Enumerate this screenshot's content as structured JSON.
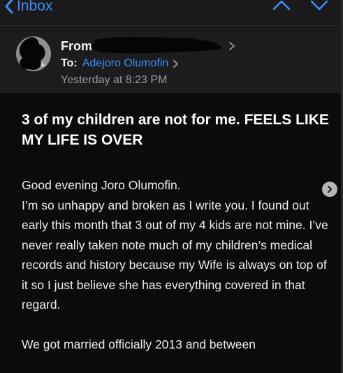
{
  "nav": {
    "back_label": "Inbox"
  },
  "header": {
    "from_label": "From",
    "to_label": "To:",
    "to_name": "Adejoro Olumofin",
    "date": "Yesterday at 8:23 PM"
  },
  "email": {
    "subject": "3 of my children are not for me. FEELS LIKE MY LIFE IS OVER",
    "greeting": "Good evening Joro Olumofin.",
    "paragraph1": "I’m so unhappy and broken as I write you. I found out early this month that 3 out of my 4 kids are not mine. I’ve never really taken note much of my children’s medical records and history because my Wife is always on top of it so I just believe she has everything covered in that regard.",
    "paragraph2": "We got married officially 2013 and between"
  },
  "colors": {
    "accent": "#3d8ef7",
    "background": "#0b0b0c",
    "header_bg": "#1c1c1e"
  },
  "icons": [
    "chevron-left-icon",
    "chevron-up-icon",
    "chevron-down-icon",
    "avatar-icon",
    "chevron-right-icon"
  ]
}
